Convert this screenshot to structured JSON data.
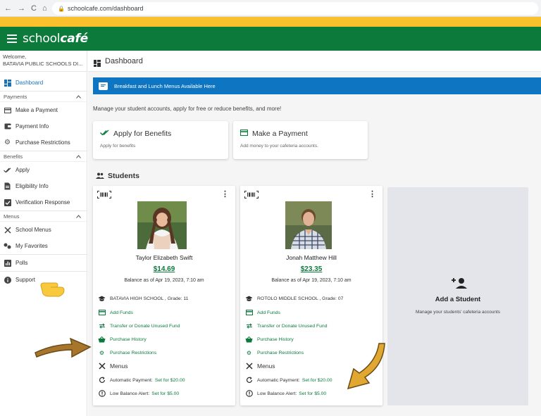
{
  "browser": {
    "nav_back": "←",
    "nav_forward": "→",
    "nav_reload": "C",
    "nav_home": "⌂",
    "url": "schoolcafe.com/dashboard"
  },
  "app": {
    "logo_text_a": "school",
    "logo_text_b": "café",
    "accent_green": "#0b7a3b",
    "banner_blue": "#0e75c2",
    "band_yellow": "#fbc12d"
  },
  "sidebar": {
    "welcome": "Welcome,",
    "district": "BATAVIA PUBLIC SCHOOLS DI...",
    "dashboard": "Dashboard",
    "payments_section": "Payments",
    "make_payment": "Make a Payment",
    "payment_info": "Payment Info",
    "purchase_restrictions": "Purchase Restrictions",
    "benefits_section": "Benefits",
    "apply": "Apply",
    "eligibility_info": "Eligibility Info",
    "verification_response": "Verification Response",
    "menus_section": "Menus",
    "school_menus": "School Menus",
    "my_favorites": "My Favorites",
    "polls": "Polls",
    "support": "Support"
  },
  "main": {
    "page_title": "Dashboard",
    "banner": "Breakfast and Lunch Menus Available Here",
    "intro": "Manage your student accounts, apply for free or reduce benefits, and more!",
    "apply_title": "Apply for Benefits",
    "apply_sub": "Apply for benefits",
    "pay_title": "Make a Payment",
    "pay_sub": "Add money to your cafeteria accounts.",
    "students_heading": "Students"
  },
  "students": [
    {
      "name": "Taylor Elizabeth Swift",
      "balance": "$14.69",
      "as_of": "Balance as of Apr 19, 2023, 7:10 am",
      "school": "BATAVIA HIGH SCHOOL , Grade: 11",
      "add_funds": "Add Funds",
      "transfer": "Transfer or Donate Unused Fund",
      "history": "Purchase History",
      "restrictions": "Purchase Restrictions",
      "menus": "Menus",
      "auto_label": "Automatic Payment:",
      "auto_value": "Set for $20.00",
      "low_label": "Low Balance Alert:",
      "low_value": "Set for $5.00"
    },
    {
      "name": "Jonah Matthew  Hill",
      "balance": "$23.35",
      "as_of": "Balance as of Apr 19, 2023, 7:10 am",
      "school": "ROTOLO MIDDLE SCHOOL , Grade: 07",
      "add_funds": "Add Funds",
      "transfer": "Transfer or Donate Unused Fund",
      "history": "Purchase History",
      "restrictions": "Purchase Restrictions",
      "menus": "Menus",
      "auto_label": "Automatic Payment:",
      "auto_value": "Set for $20.00",
      "low_label": "Low Balance Alert:",
      "low_value": "Set for $5.00"
    }
  ],
  "add_student": {
    "title": "Add a Student",
    "desc": "Manage your students' cafeteria accounts"
  }
}
